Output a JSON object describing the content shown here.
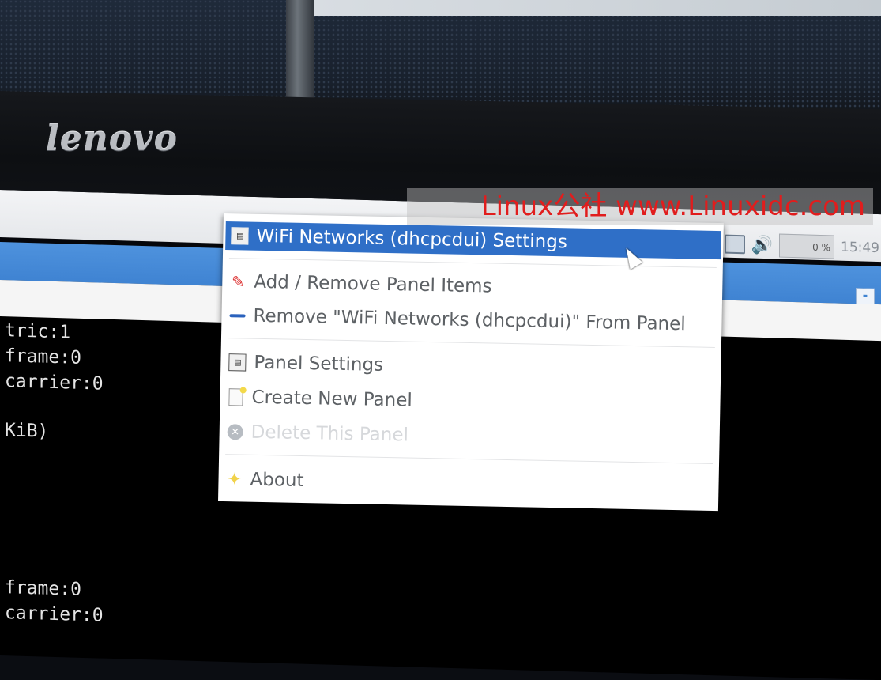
{
  "brand": {
    "logo": "lenovo"
  },
  "watermark": {
    "text": "Linux公社 www.Linuxidc.com"
  },
  "tray": {
    "clock": "15:49",
    "cpu": "0 %"
  },
  "title_bar": {
    "button": "-"
  },
  "terminal": {
    "lines": [
      "tric:1",
      "frame:0",
      "carrier:0",
      "",
      "KiB)",
      "",
      "",
      "",
      "",
      "frame:0",
      "carrier:0"
    ]
  },
  "context_menu": {
    "items": [
      {
        "label": "WiFi Networks (dhcpcdui) Settings",
        "icon": "panel-settings-icon",
        "highlighted": true
      },
      {
        "label": "Add / Remove Panel Items",
        "icon": "pencil-icon"
      },
      {
        "label": "Remove \"WiFi Networks (dhcpcdui)\" From Panel",
        "icon": "minus-icon"
      },
      {
        "label": "Panel Settings",
        "icon": "panel-settings-icon"
      },
      {
        "label": "Create New Panel",
        "icon": "new-panel-icon"
      },
      {
        "label": "Delete This Panel",
        "icon": "delete-icon",
        "disabled": true
      },
      {
        "label": "About",
        "icon": "about-icon"
      }
    ]
  },
  "colors": {
    "highlight": "#2f6fc7",
    "title_bar": "#3f83d2",
    "watermark": "#e11d1d"
  }
}
